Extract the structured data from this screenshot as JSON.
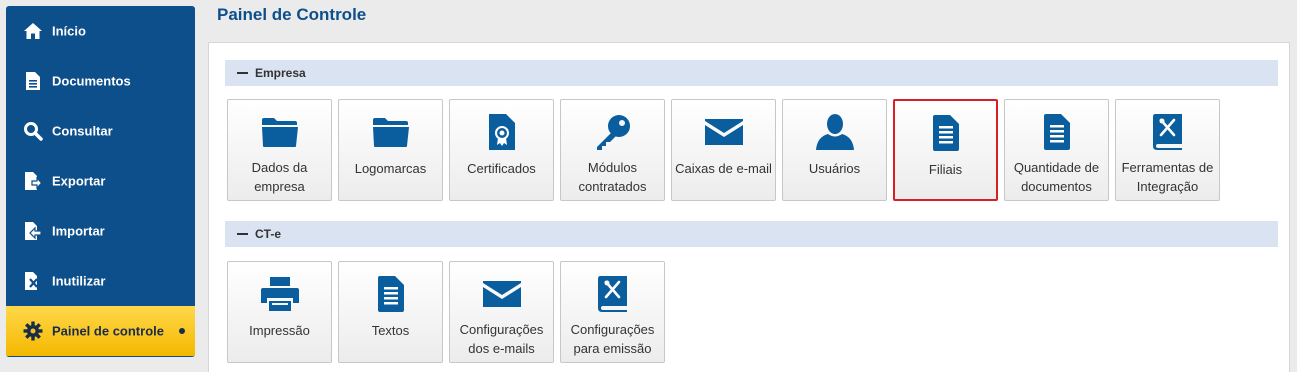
{
  "page_title": "Painel de Controle",
  "sidebar": {
    "items": [
      {
        "label": "Início",
        "icon": "home-icon"
      },
      {
        "label": "Documentos",
        "icon": "document-icon"
      },
      {
        "label": "Consultar",
        "icon": "search-icon"
      },
      {
        "label": "Exportar",
        "icon": "export-icon"
      },
      {
        "label": "Importar",
        "icon": "import-icon"
      },
      {
        "label": "Inutilizar",
        "icon": "invalidate-icon"
      },
      {
        "label": "Painel de controle",
        "icon": "gear-icon",
        "active": true
      }
    ]
  },
  "sections": [
    {
      "title": "Empresa",
      "tiles": [
        {
          "line1": "Dados da",
          "line2": "empresa",
          "icon": "folder-icon"
        },
        {
          "line1": "Logomarcas",
          "line2": "",
          "icon": "folder-icon"
        },
        {
          "line1": "Certificados",
          "line2": "",
          "icon": "certificate-icon"
        },
        {
          "line1": "Módulos",
          "line2": "contratados",
          "icon": "key-icon"
        },
        {
          "line1": "Caixas de e-mail",
          "line2": "",
          "icon": "envelope-icon"
        },
        {
          "line1": "Usuários",
          "line2": "",
          "icon": "user-icon"
        },
        {
          "line1": "Filiais",
          "line2": "",
          "icon": "document-icon",
          "selected": true
        },
        {
          "line1": "Quantidade de",
          "line2": "documentos",
          "icon": "document-icon"
        },
        {
          "line1": "Ferramentas de",
          "line2": "Integração",
          "icon": "tools-book-icon"
        }
      ]
    },
    {
      "title": "CT-e",
      "tiles": [
        {
          "line1": "Impressão",
          "line2": "",
          "icon": "printer-icon"
        },
        {
          "line1": "Textos",
          "line2": "",
          "icon": "document-icon"
        },
        {
          "line1": "Configurações",
          "line2": "dos e-mails",
          "icon": "envelope-icon"
        },
        {
          "line1": "Configurações",
          "line2": "para emissão",
          "icon": "tools-book-icon"
        }
      ]
    }
  ],
  "colors": {
    "brand_blue": "#0d4f8b",
    "icon_blue": "#0b5e9e",
    "active_yellow": "#f4b800",
    "selected_border": "#d71f26",
    "section_bar": "#d9e3f1"
  }
}
